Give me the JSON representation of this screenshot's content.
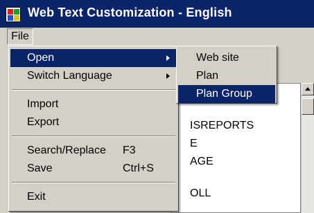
{
  "window": {
    "title": "Web Text Customization - English"
  },
  "menubar": {
    "file_label": "File"
  },
  "file_menu": {
    "items": [
      {
        "label": "Open",
        "shortcut": "",
        "submenu": true,
        "highlighted": true
      },
      {
        "label": "Switch Language",
        "shortcut": "",
        "submenu": true,
        "highlighted": false
      },
      {
        "label": "Import",
        "shortcut": ""
      },
      {
        "label": "Export",
        "shortcut": ""
      },
      {
        "label": "Search/Replace",
        "shortcut": "F3"
      },
      {
        "label": "Save",
        "shortcut": "Ctrl+S"
      },
      {
        "label": "Exit",
        "shortcut": ""
      }
    ]
  },
  "open_submenu": {
    "items": [
      {
        "label": "Web site",
        "highlighted": false
      },
      {
        "label": "Plan",
        "highlighted": false
      },
      {
        "label": "Plan Group",
        "highlighted": true
      }
    ]
  },
  "tree": {
    "visible_fragments": [
      "ISREPORTS",
      "E",
      "AGE",
      "OLL"
    ]
  },
  "colors": {
    "highlight": "#0a246a",
    "face": "#d4d0c8",
    "highlight_text": "#ffffff"
  }
}
